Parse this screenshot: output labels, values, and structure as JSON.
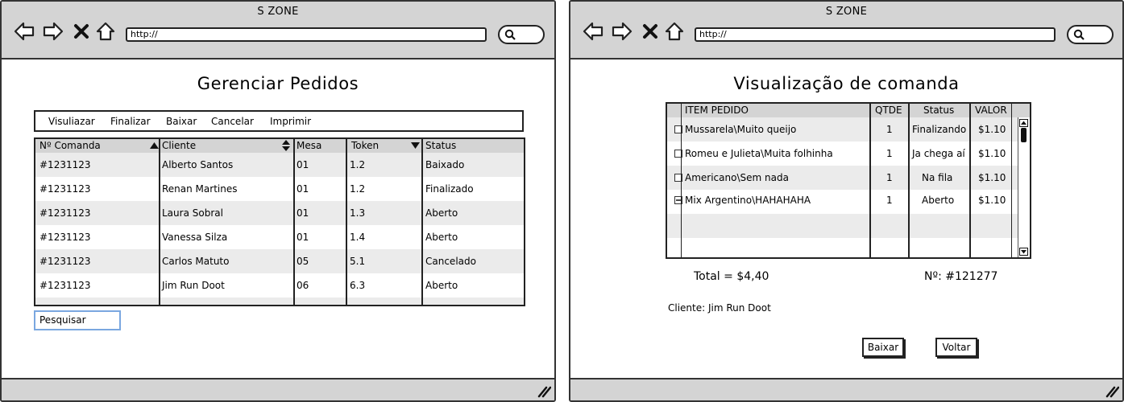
{
  "left_window": {
    "title": "S ZONE",
    "url": "http://",
    "heading": "Gerenciar Pedidos",
    "menu": [
      "Visuliazar",
      "Finalizar",
      "Baixar",
      "Cancelar",
      "Imprimir"
    ],
    "table": {
      "columns": [
        "Nº Comanda",
        "Cliente",
        "Mesa",
        "Token",
        "Status"
      ],
      "rows": [
        [
          "#1231123",
          "Alberto Santos",
          "01",
          "1.2",
          "Baixado"
        ],
        [
          "#1231123",
          "Renan Martines",
          "01",
          "1.2",
          "Finalizado"
        ],
        [
          "#1231123",
          "Laura Sobral",
          "01",
          "1.3",
          "Aberto"
        ],
        [
          "#1231123",
          "Vanessa Silza",
          "01",
          "1.4",
          "Aberto"
        ],
        [
          "#1231123",
          "Carlos Matuto",
          "05",
          "5.1",
          "Cancelado"
        ],
        [
          "#1231123",
          "Jim Run Doot",
          "06",
          "6.3",
          "Aberto"
        ]
      ]
    },
    "search_field": "Pesquisar"
  },
  "right_window": {
    "title": "S ZONE",
    "url": "http://",
    "heading": "Visualização de comanda",
    "table": {
      "columns": [
        "ITEM PEDIDO",
        "QTDE",
        "Status",
        "VALOR"
      ],
      "rows": [
        [
          "Mussarela\\Muito queijo",
          "1",
          "Finalizando",
          "$1.10"
        ],
        [
          "Romeu e Julieta\\Muita folhinha",
          "1",
          "Ja chega aí",
          "$1.10"
        ],
        [
          "Americano\\Sem nada",
          "1",
          "Na fila",
          "$1.10"
        ],
        [
          "Mix Argentino\\HAHAHAHA",
          "1",
          "Aberto",
          "$1.10"
        ]
      ]
    },
    "total": "Total = $4,40",
    "number": "Nº: #121277",
    "cliente": "Cliente: Jim Run Doot",
    "buttons": {
      "baixar": "Baixar",
      "voltar": "Voltar"
    }
  },
  "colors": {
    "chrome_gray": "#d4d4d4",
    "row_alt": "#ebebeb",
    "border": "#222222",
    "search_focus": "#7aa7e0"
  },
  "icons": [
    "back-arrow-icon",
    "forward-arrow-icon",
    "close-icon",
    "home-icon",
    "search-icon",
    "resize-grip-icon",
    "sort-up-icon",
    "sort-both-icon",
    "sort-down-icon",
    "scroll-up-icon",
    "scroll-down-icon",
    "checkbox-icon"
  ]
}
